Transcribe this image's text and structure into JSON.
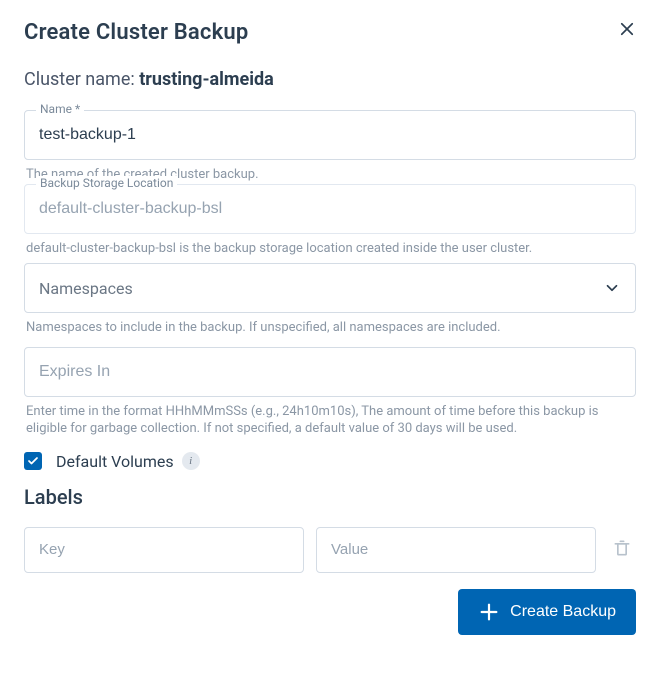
{
  "dialog": {
    "title": "Create Cluster Backup",
    "close_icon": "close"
  },
  "cluster": {
    "label": "Cluster name: ",
    "name": "trusting-almeida"
  },
  "name_field": {
    "label": "Name *",
    "value": "test-backup-1",
    "helper": "The name of the created cluster backup."
  },
  "bsl_field": {
    "label": "Backup Storage Location",
    "value": "default-cluster-backup-bsl",
    "helper": "default-cluster-backup-bsl is the backup storage location created inside the user cluster."
  },
  "namespaces_field": {
    "placeholder": "Namespaces",
    "helper": "Namespaces to include in the backup. If unspecified, all namespaces are included."
  },
  "expires_field": {
    "placeholder": "Expires In",
    "helper": "Enter time in the format HHhMMmSSs (e.g., 24h10m10s), The amount of time before this backup is eligible for garbage collection. If not specified, a default value of 30 days will be used."
  },
  "default_volumes": {
    "checked": true,
    "label": "Default Volumes",
    "info": "i"
  },
  "labels_section": {
    "title": "Labels",
    "key_placeholder": "Key",
    "value_placeholder": "Value"
  },
  "footer": {
    "create_label": "Create Backup"
  }
}
